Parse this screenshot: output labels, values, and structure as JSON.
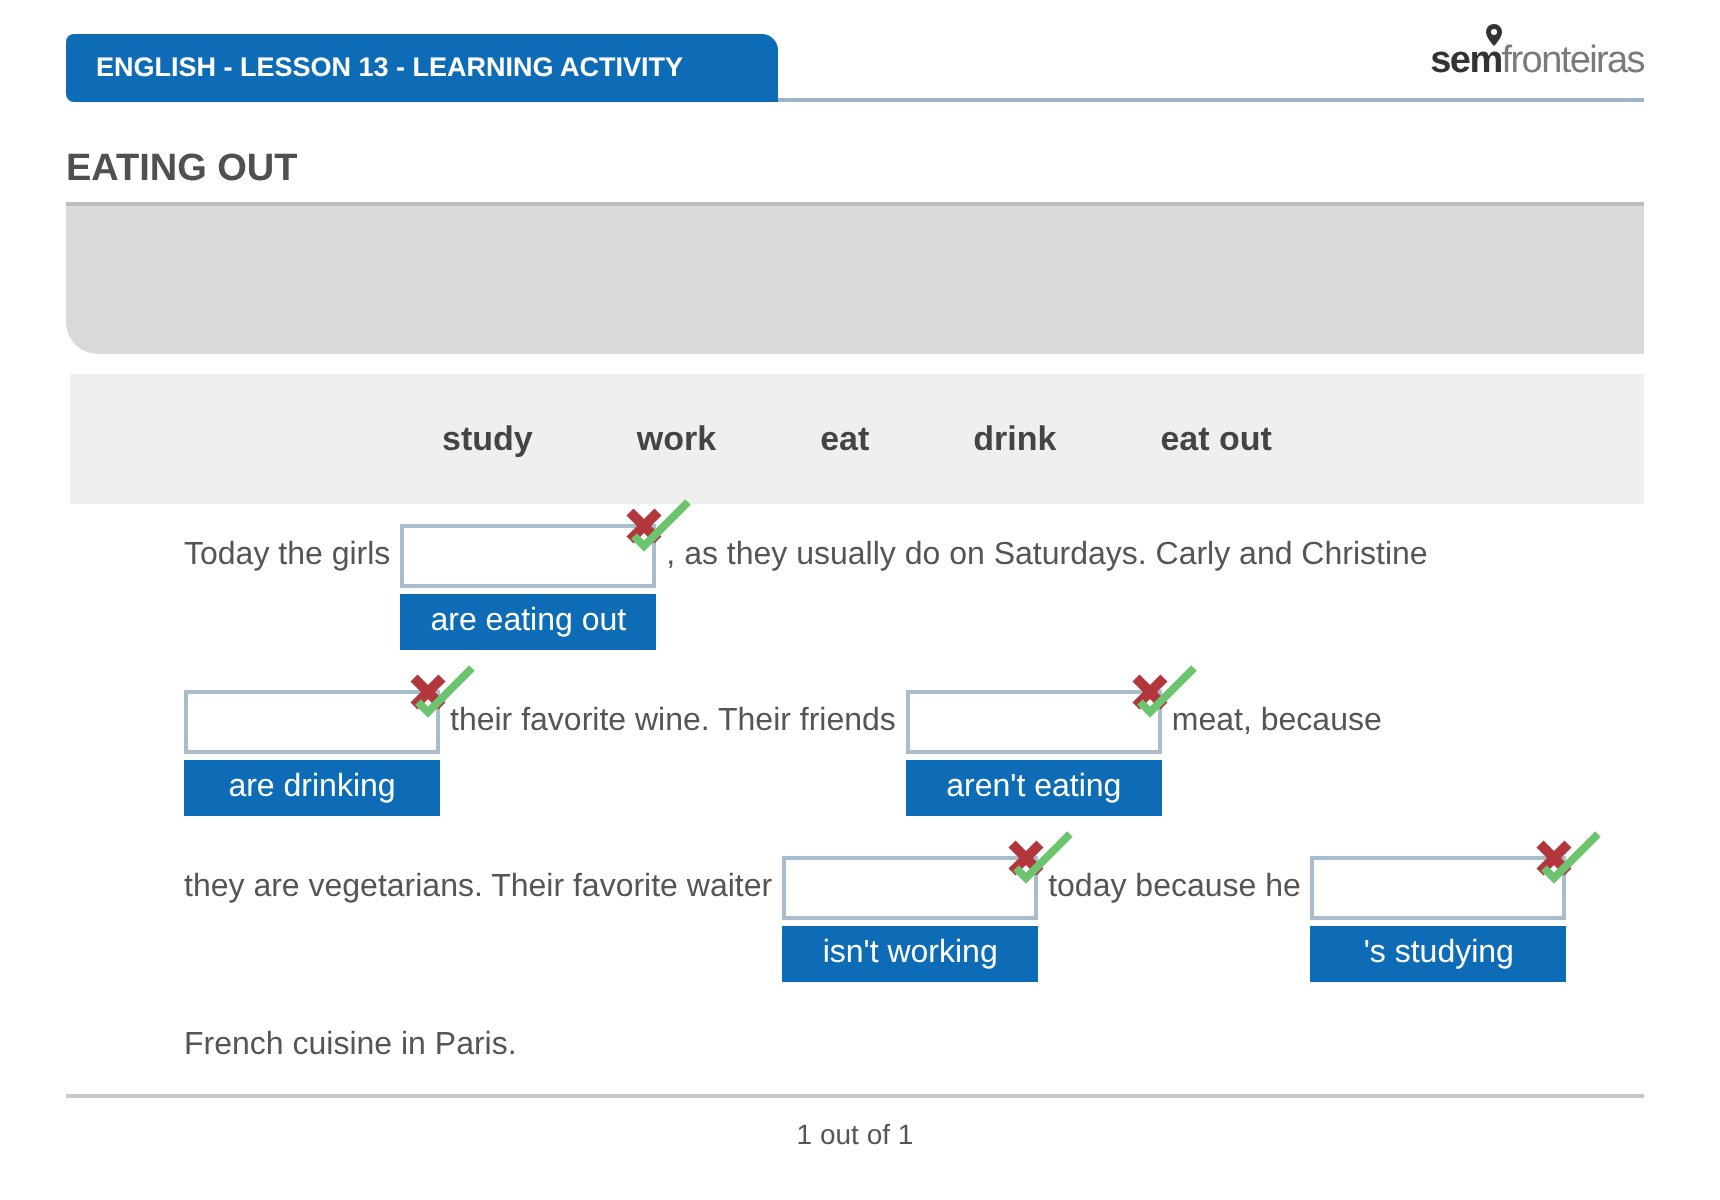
{
  "header": {
    "title": "ENGLISH - LESSON 13 - LEARNING ACTIVITY",
    "logo": {
      "bold": "sem",
      "light": "fronteiras"
    }
  },
  "activity_title": "EATING OUT",
  "word_bank": [
    "study",
    "work",
    "eat",
    "drink",
    "eat out"
  ],
  "lines": [
    [
      {
        "kind": "text",
        "text": "Today the girls"
      },
      {
        "kind": "gap",
        "answer": "are eating out"
      },
      {
        "kind": "text",
        "text": ", as they usually do on Saturdays. Carly and Christine"
      }
    ],
    [
      {
        "kind": "gap",
        "answer": "are drinking"
      },
      {
        "kind": "text",
        "text": "their favorite wine. Their friends"
      },
      {
        "kind": "gap",
        "answer": "aren't eating"
      },
      {
        "kind": "text",
        "text": "meat, because"
      }
    ],
    [
      {
        "kind": "text",
        "text": "they are vegetarians. Their favorite waiter"
      },
      {
        "kind": "gap",
        "answer": "isn't working"
      },
      {
        "kind": "text",
        "text": "today because he"
      },
      {
        "kind": "gap",
        "answer": "'s studying"
      }
    ],
    [
      {
        "kind": "text",
        "text": "French cuisine in Paris."
      }
    ]
  ],
  "pager": "1 out of 1"
}
